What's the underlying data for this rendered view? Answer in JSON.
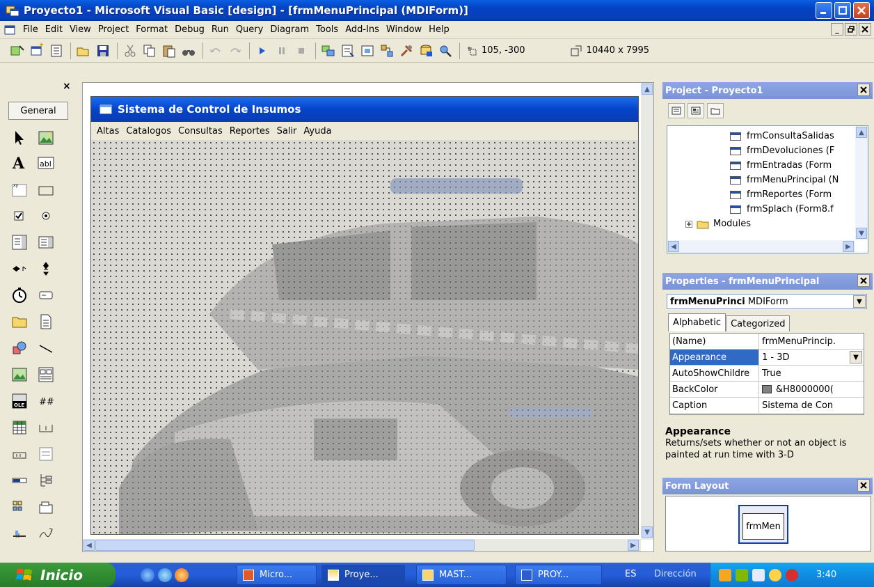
{
  "window": {
    "title": "Proyecto1 - Microsoft Visual Basic [design] - [frmMenuPrincipal (MDIForm)]"
  },
  "menubar": {
    "items": [
      "File",
      "Edit",
      "View",
      "Project",
      "Format",
      "Debug",
      "Run",
      "Query",
      "Diagram",
      "Tools",
      "Add-Ins",
      "Window",
      "Help"
    ]
  },
  "toolbar": {
    "position": "105, -300",
    "size": "10440 x 7995"
  },
  "toolbox": {
    "tab_label": "General",
    "close": "×"
  },
  "designer_form": {
    "title": "Sistema de Control de Insumos",
    "menu": [
      "Altas",
      "Catalogos",
      "Consultas",
      "Reportes",
      "Salir",
      "Ayuda"
    ]
  },
  "project_pane": {
    "title": "Project - Proyecto1",
    "nodes": [
      "frmConsultaSalidas",
      "frmDevoluciones (F",
      "frmEntradas (Form",
      "frmMenuPrincipal (N",
      "frmReportes (Form",
      "frmSplach (Form8.f",
      "Modules"
    ]
  },
  "properties_pane": {
    "title": "Properties - frmMenuPrincipal",
    "object_name": "frmMenuPrinci",
    "object_type": "MDIForm",
    "tabs": [
      "Alphabetic",
      "Categorized"
    ],
    "rows": [
      {
        "name": "(Name)",
        "value": "frmMenuPrincip."
      },
      {
        "name": "Appearance",
        "value": "1 - 3D"
      },
      {
        "name": "AutoShowChildre",
        "value": "True"
      },
      {
        "name": "BackColor",
        "value": "&H8000000("
      },
      {
        "name": "Caption",
        "value": "Sistema de Con"
      }
    ]
  },
  "description_pane": {
    "heading": "Appearance",
    "text": "Returns/sets whether or not an object is painted at run time with 3-D"
  },
  "layout_pane": {
    "title": "Form Layout",
    "mini_label": "frmMen"
  },
  "taskbar": {
    "start": "Inicio",
    "buttons": [
      "Micro...",
      "Proye...",
      "MAST...",
      "PROY..."
    ],
    "lang": "ES",
    "address": "Dirección",
    "clock": "3:40"
  },
  "colors": {
    "titlebar": "#0a4fd6",
    "pane_title": "#7f98da",
    "selection": "#316ac5",
    "taskbar": "#245edb",
    "start": "#2f8a2f"
  }
}
